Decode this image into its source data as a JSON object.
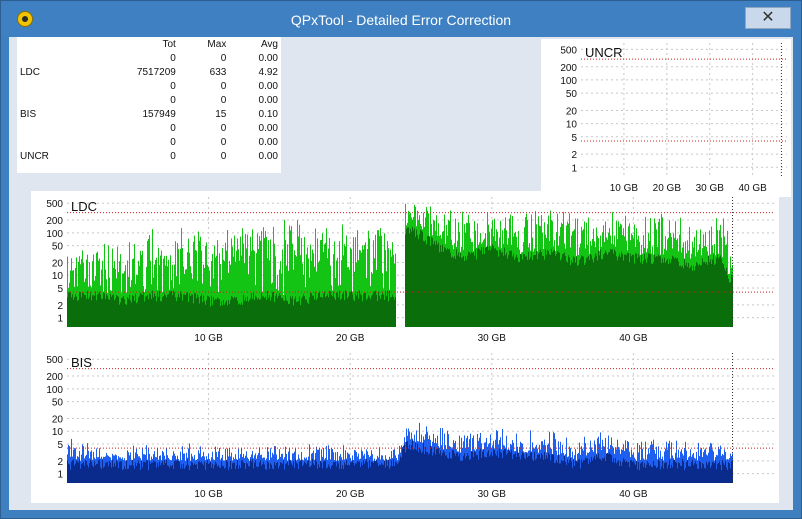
{
  "window": {
    "title": "QPxTool - Detailed Error Correction",
    "close_glyph": "✕"
  },
  "stats": {
    "headers": [
      "",
      "Tot",
      "Max",
      "Avg"
    ],
    "rows": [
      [
        "",
        "0",
        "0",
        "0.00"
      ],
      [
        "LDC",
        "7517209",
        "633",
        "4.92"
      ],
      [
        "",
        "0",
        "0",
        "0.00"
      ],
      [
        "",
        "0",
        "0",
        "0.00"
      ],
      [
        "BIS",
        "157949",
        "15",
        "0.10"
      ],
      [
        "",
        "0",
        "0",
        "0.00"
      ],
      [
        "",
        "0",
        "0",
        "0.00"
      ],
      [
        "UNCR",
        "0",
        "0",
        "0.00"
      ]
    ]
  },
  "colors": {
    "ldc_light": "#14c414",
    "ldc_dark": "#0a6e0a",
    "bis_light": "#1f5ff0",
    "bis_dark": "#0a2a8c",
    "threshold": "#cc2222"
  },
  "chart_data": [
    {
      "name": "UNCR",
      "type": "bar",
      "title": "UNCR",
      "x_ticks": [
        "10 GB",
        "20 GB",
        "30 GB",
        "40 GB"
      ],
      "x_tick_values": [
        10,
        20,
        30,
        40
      ],
      "xlim": [
        0,
        48
      ],
      "y_ticks": [
        "1",
        "2",
        "5",
        "10",
        "20",
        "50",
        "100",
        "200",
        "500"
      ],
      "yscale": "log",
      "ylim": [
        0.6,
        700
      ],
      "threshold_lines": [
        4,
        300
      ],
      "disc_end_gb": 46.7,
      "series": []
    },
    {
      "name": "LDC",
      "type": "bar",
      "title": "LDC",
      "x_ticks": [
        "10 GB",
        "20 GB",
        "30 GB",
        "40 GB"
      ],
      "x_tick_values": [
        10,
        20,
        30,
        40
      ],
      "xlim": [
        0,
        50
      ],
      "y_ticks": [
        "1",
        "2",
        "5",
        "10",
        "20",
        "50",
        "100",
        "200",
        "500"
      ],
      "yscale": "log",
      "ylim": [
        0.6,
        700
      ],
      "threshold_lines": [
        4,
        300
      ],
      "disc_end_gb": 47,
      "series": [
        {
          "x": [
            0,
            2,
            4,
            6,
            8,
            10,
            12,
            14,
            16,
            18,
            20,
            22,
            23.4,
            24,
            26,
            28,
            30,
            32,
            34,
            36,
            38,
            40,
            42,
            44,
            46,
            46.7
          ],
          "light": [
            40,
            60,
            80,
            120,
            150,
            120,
            150,
            180,
            250,
            150,
            200,
            180,
            200,
            600,
            400,
            300,
            400,
            350,
            400,
            300,
            400,
            250,
            300,
            200,
            250,
            150
          ],
          "dark": [
            4,
            4,
            3,
            4,
            4,
            3,
            3,
            4,
            3,
            4,
            4,
            4,
            4,
            150,
            60,
            30,
            50,
            30,
            40,
            25,
            40,
            30,
            30,
            20,
            30,
            10
          ]
        }
      ]
    },
    {
      "name": "BIS",
      "type": "bar",
      "title": "BIS",
      "x_ticks": [
        "10 GB",
        "20 GB",
        "30 GB",
        "40 GB"
      ],
      "x_tick_values": [
        10,
        20,
        30,
        40
      ],
      "xlim": [
        0,
        50
      ],
      "y_ticks": [
        "1",
        "2",
        "5",
        "10",
        "20",
        "50",
        "100",
        "200",
        "500"
      ],
      "yscale": "log",
      "ylim": [
        0.6,
        700
      ],
      "threshold_lines": [
        4,
        300
      ],
      "disc_end_gb": 47,
      "series": [
        {
          "x": [
            0,
            2,
            4,
            6,
            8,
            10,
            12,
            14,
            16,
            18,
            20,
            22,
            23.4,
            24,
            26,
            28,
            30,
            32,
            34,
            36,
            38,
            40,
            42,
            44,
            46,
            46.7
          ],
          "light": [
            7,
            3,
            4,
            3,
            4,
            3,
            4,
            3,
            3,
            4,
            3,
            3,
            3,
            14,
            11,
            8,
            10,
            8,
            9,
            6,
            8,
            5,
            6,
            4,
            5,
            3
          ],
          "dark": [
            2,
            2,
            2,
            2,
            2,
            2,
            2,
            2,
            2,
            2,
            2,
            2,
            2,
            6,
            4,
            3,
            4,
            3,
            3,
            2,
            3,
            2,
            2,
            2,
            2,
            2
          ]
        }
      ]
    }
  ]
}
